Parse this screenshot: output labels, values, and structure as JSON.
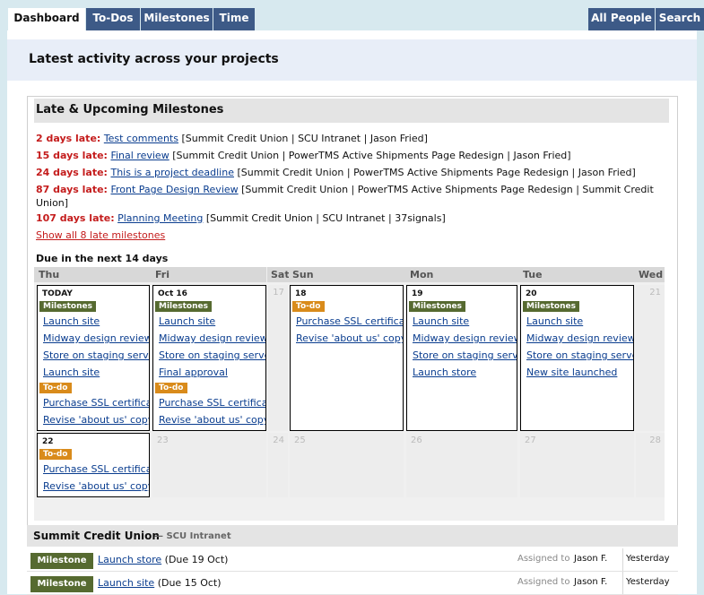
{
  "nav": {
    "tabs": [
      {
        "label": "Dashboard",
        "active": true
      },
      {
        "label": "To-Dos"
      },
      {
        "label": "Milestones"
      },
      {
        "label": "Time"
      }
    ],
    "right_tabs": [
      {
        "label": "All People"
      },
      {
        "label": "Search"
      }
    ]
  },
  "page_title": "Latest activity across your projects",
  "milestones_box": {
    "title": "Late & Upcoming Milestones",
    "late": [
      {
        "days": "2 days late:",
        "link": "Test comments",
        "info": " [Summit Credit Union | SCU Intranet | Jason Fried]"
      },
      {
        "days": "15 days late:",
        "link": "Final review",
        "info": " [Summit Credit Union | PowerTMS Active Shipments Page Redesign | Jason Fried]"
      },
      {
        "days": "24 days late:",
        "link": "This is a project deadline",
        "info": " [Summit Credit Union | PowerTMS Active Shipments Page Redesign | Jason Fried]"
      },
      {
        "days": "87 days late:",
        "link": "Front Page Design Review",
        "info": " [Summit Credit Union | PowerTMS Active Shipments Page Redesign | Summit Credit Union]"
      },
      {
        "days": "107 days late:",
        "link": "Planning Meeting",
        "info": " [Summit Credit Union | SCU Intranet | 37signals]"
      }
    ],
    "show_all": "Show all 8 late milestones",
    "due_title": "Due in the next 14 days"
  },
  "calendar": {
    "day_headers": [
      "Thu",
      "Fri",
      "Sat",
      "Sun",
      "Mon",
      "Tue",
      "Wed"
    ],
    "week1": {
      "today": {
        "label": "TODAY",
        "milestones_badge": "Milestones",
        "milestones": [
          "Launch site",
          "Midway design review",
          "Store on staging server",
          "Launch site"
        ],
        "todo_badge": "To-do",
        "todos": [
          "Purchase SSL certificate",
          "Revise 'about us' copy"
        ]
      },
      "oct16": {
        "label": "Oct 16",
        "milestones_badge": "Milestones",
        "milestones": [
          "Launch site",
          "Midway design review",
          "Store on staging server",
          "Final approval"
        ],
        "todo_badge": "To-do",
        "todos": [
          "Purchase SSL certificate",
          "Revise 'about us' copy"
        ]
      },
      "sat_num": "17",
      "d18": {
        "label": "18",
        "todo_badge": "To-do",
        "todos": [
          "Purchase SSL certificate",
          "Revise 'about us' copy"
        ]
      },
      "d19": {
        "label": "19",
        "milestones_badge": "Milestones",
        "milestones": [
          "Launch site",
          "Midway design review",
          "Store on staging server",
          "Launch store"
        ]
      },
      "d20": {
        "label": "20",
        "milestones_badge": "Milestones",
        "milestones": [
          "Launch site",
          "Midway design review",
          "Store on staging server",
          "New site launched"
        ]
      },
      "wed_num": "21"
    },
    "week2": {
      "d22": {
        "label": "22",
        "todo_badge": "To-do",
        "todos": [
          "Purchase SSL certificate",
          "Revise 'about us' copy"
        ]
      },
      "nums": [
        "23",
        "24",
        "25",
        "26",
        "27",
        "28"
      ]
    }
  },
  "project": {
    "name": "Summit Credit Union",
    "sub": "— SCU Intranet",
    "rows": [
      {
        "badge": "Milestone",
        "link": "Launch store",
        "due": " (Due 19 Oct)",
        "assigned_label": "Assigned to",
        "assignee": "Jason F.",
        "when": "Yesterday"
      },
      {
        "badge": "Milestone",
        "link": "Launch site",
        "due": " (Due 15 Oct)",
        "assigned_label": "Assigned to",
        "assignee": "Jason F.",
        "when": "Yesterday"
      }
    ]
  }
}
